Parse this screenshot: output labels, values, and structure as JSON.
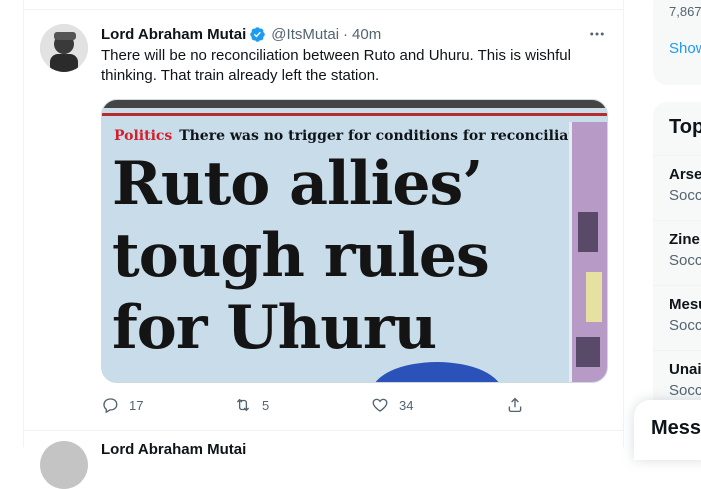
{
  "tweet": {
    "display_name": "Lord Abraham Mutai",
    "handle": "@ItsMutai",
    "separator": "·",
    "time": "40m",
    "text": "There will be no reconciliation between Ruto and Uhuru. This is wishful thinking. That train already left the station.",
    "media": {
      "kicker_tag": "Politics",
      "kicker_text": "There was no trigger for conditions for reconciliation",
      "headline_lines": [
        "Ruto allies’",
        "tough rules",
        "for Uhuru"
      ]
    },
    "actions": {
      "replies": "17",
      "retweets": "5",
      "likes": "34"
    }
  },
  "next_tweet": {
    "display_name": "Lord Abraham Mutai"
  },
  "sidebar": {
    "count_text": "7,867",
    "show_link": "Show",
    "topics_title": "Top",
    "topics": [
      {
        "name": "Arse",
        "category": "Socc"
      },
      {
        "name": "Zine",
        "category": "Socc"
      },
      {
        "name": "Mesu",
        "category": "Socc"
      },
      {
        "name": "Unai",
        "category": "Socc"
      }
    ]
  },
  "messages_label": "Messa",
  "colors": {
    "accent": "#1d9bf0",
    "text": "#0f1419",
    "muted": "#536471",
    "verified": "#1d9bf0"
  }
}
